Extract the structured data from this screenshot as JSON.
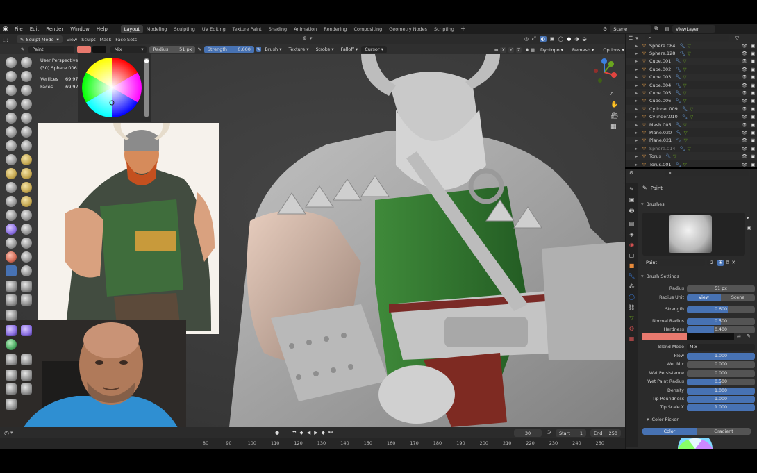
{
  "menubar": {
    "items": [
      "File",
      "Edit",
      "Render",
      "Window",
      "Help"
    ],
    "workspaces": [
      "Layout",
      "Modeling",
      "Sculpting",
      "UV Editing",
      "Texture Paint",
      "Shading",
      "Animation",
      "Rendering",
      "Compositing",
      "Geometry Nodes",
      "Scripting"
    ],
    "active_workspace": "Layout",
    "scene": "Scene",
    "view_layer": "ViewLayer"
  },
  "header": {
    "mode": "Sculpt Mode",
    "items": [
      "View",
      "Sculpt",
      "Mask",
      "Face Sets"
    ]
  },
  "tool_settings": {
    "brush_name": "Paint",
    "blend": "Mix",
    "radius_label": "Radius",
    "radius_value": "51 px",
    "strength_label": "Strength",
    "strength_value": "0.600",
    "menus": [
      "Brush",
      "Texture",
      "Stroke",
      "Falloff",
      "Cursor"
    ],
    "axes": [
      "X",
      "Y",
      "Z"
    ],
    "right_menus": [
      "Dyntopo",
      "Remesh",
      "Options"
    ],
    "accent_color": "#e8796e"
  },
  "viewport": {
    "view_name": "User Perspective",
    "object_name": "(30) Sphere.006",
    "vertices_label": "Vertices",
    "vertices_value": "69,976",
    "faces_label": "Faces",
    "faces_value": "69,974"
  },
  "outliner": {
    "search_placeholder": "",
    "items": [
      {
        "name": "Sphere.084",
        "icon": "object-icon"
      },
      {
        "name": "Sphere.128",
        "icon": "object-icon"
      },
      {
        "name": "Cube.001",
        "icon": "object-icon"
      },
      {
        "name": "Cube.002",
        "icon": "object-icon"
      },
      {
        "name": "Cube.003",
        "icon": "object-icon"
      },
      {
        "name": "Cube.004",
        "icon": "object-icon"
      },
      {
        "name": "Cube.005",
        "icon": "object-icon"
      },
      {
        "name": "Cube.006",
        "icon": "object-icon"
      },
      {
        "name": "Cylinder.009",
        "icon": "object-icon"
      },
      {
        "name": "Cylinder.010",
        "icon": "object-icon"
      },
      {
        "name": "Mesh.005",
        "icon": "object-icon"
      },
      {
        "name": "Plane.020",
        "icon": "object-icon"
      },
      {
        "name": "Plane.021",
        "icon": "object-icon"
      },
      {
        "name": "Sphere.014",
        "icon": "object-icon"
      },
      {
        "name": "Torus",
        "icon": "object-icon"
      },
      {
        "name": "Torus.001",
        "icon": "object-icon"
      }
    ]
  },
  "properties": {
    "tool_name": "Paint",
    "brushes_panel": "Brushes",
    "brush_name": "Paint",
    "brush_users": "2",
    "brush_settings_panel": "Brush Settings",
    "rows": [
      {
        "label": "Radius",
        "value": "51 px",
        "fill": 0.0
      },
      {
        "label": "Radius Unit",
        "value": "",
        "fill": 0.0
      },
      {
        "label": "Strength",
        "value": "0.600",
        "fill": 0.6
      },
      {
        "label": "Normal Radius",
        "value": "0.500",
        "fill": 0.5
      },
      {
        "label": "Hardness",
        "value": "0.400",
        "fill": 0.4
      },
      {
        "label": "Blend Mode",
        "value": "Mix",
        "fill": 0.0
      },
      {
        "label": "Flow",
        "value": "1.000",
        "fill": 1.0
      },
      {
        "label": "Wet Mix",
        "value": "0.000",
        "fill": 0.0
      },
      {
        "label": "Wet Persistence",
        "value": "0.000",
        "fill": 0.0
      },
      {
        "label": "Wet Paint Radius",
        "value": "0.500",
        "fill": 0.5
      },
      {
        "label": "Density",
        "value": "1.000",
        "fill": 1.0
      },
      {
        "label": "Tip Roundness",
        "value": "1.000",
        "fill": 1.0
      },
      {
        "label": "Tip Scale X",
        "value": "1.000",
        "fill": 1.0
      }
    ],
    "radius_unit_options": [
      "View",
      "Scene"
    ],
    "color_picker_panel": "Color Picker",
    "color_picker_tabs": [
      "Color",
      "Gradient"
    ],
    "brush_color": "#e8796e"
  },
  "timeline": {
    "current_frame": "30",
    "start_label": "Start",
    "start_value": "1",
    "end_label": "End",
    "end_value": "250",
    "ticks": [
      "80",
      "90",
      "100",
      "110",
      "120",
      "130",
      "140",
      "150",
      "160",
      "170",
      "180",
      "190",
      "200",
      "210",
      "220",
      "230",
      "240",
      "250"
    ]
  }
}
